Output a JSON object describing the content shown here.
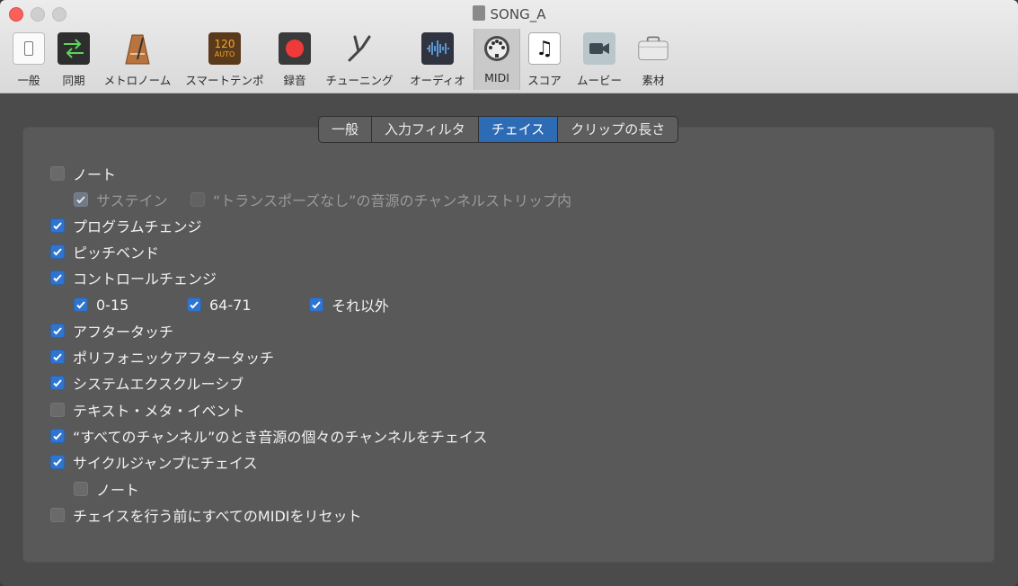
{
  "window": {
    "title": "SONG_A"
  },
  "toolbar": {
    "items": [
      {
        "label": "一般",
        "icon": "general-switch-icon"
      },
      {
        "label": "同期",
        "icon": "sync-arrows-icon"
      },
      {
        "label": "メトロノーム",
        "icon": "metronome-icon"
      },
      {
        "label": "スマートテンポ",
        "icon": "smart-tempo-icon",
        "icon_text_top": "120",
        "icon_text_bottom": "AUTO"
      },
      {
        "label": "録音",
        "icon": "record-icon"
      },
      {
        "label": "チューニング",
        "icon": "tuning-fork-icon"
      },
      {
        "label": "オーディオ",
        "icon": "audio-waveform-icon"
      },
      {
        "label": "MIDI",
        "icon": "midi-connector-icon",
        "selected": true
      },
      {
        "label": "スコア",
        "icon": "score-note-icon"
      },
      {
        "label": "ムービー",
        "icon": "movie-camera-icon"
      },
      {
        "label": "素材",
        "icon": "assets-case-icon"
      }
    ]
  },
  "tabs": [
    {
      "label": "一般"
    },
    {
      "label": "入力フィルタ"
    },
    {
      "label": "チェイス",
      "active": true
    },
    {
      "label": "クリップの長さ"
    }
  ],
  "options": {
    "note": {
      "label": "ノート",
      "checked": false
    },
    "sustain": {
      "label": "サステイン",
      "checked": true,
      "enabled": false
    },
    "no_transpose": {
      "label": "“トランスポーズなし”の音源のチャンネルストリップ内",
      "checked": false,
      "enabled": false
    },
    "program_change": {
      "label": "プログラムチェンジ",
      "checked": true
    },
    "pitch_bend": {
      "label": "ピッチベンド",
      "checked": true
    },
    "control_change": {
      "label": "コントロールチェンジ",
      "checked": true
    },
    "cc_0_15": {
      "label": "0-15",
      "checked": true
    },
    "cc_64_71": {
      "label": "64-71",
      "checked": true
    },
    "cc_other": {
      "label": "それ以外",
      "checked": true
    },
    "aftertouch": {
      "label": "アフタータッチ",
      "checked": true
    },
    "poly_aftertouch": {
      "label": "ポリフォニックアフタータッチ",
      "checked": true
    },
    "sysex": {
      "label": "システムエクスクルーシブ",
      "checked": true
    },
    "text_meta": {
      "label": "テキスト・メタ・イベント",
      "checked": false
    },
    "all_channels": {
      "label": "“すべてのチャンネル”のとき音源の個々のチャンネルをチェイス",
      "checked": true
    },
    "cycle_jump": {
      "label": "サイクルジャンプにチェイス",
      "checked": true
    },
    "cycle_note": {
      "label": "ノート",
      "checked": false
    },
    "reset_midi": {
      "label": "チェイスを行う前にすべてのMIDIをリセット",
      "checked": false
    }
  }
}
